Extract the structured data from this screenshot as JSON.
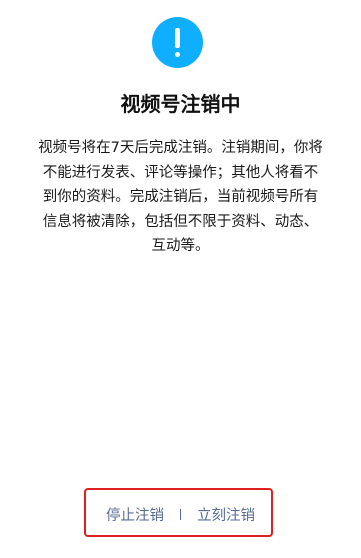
{
  "icon": {
    "name": "exclamation-icon",
    "color": "#10aeff"
  },
  "title": "视频号注销中",
  "notice_lines": [
    "视频号将在7天后完成注销。注销期间，你将",
    "不能进行发表、评论等操作；其他人将看不",
    "到你的资料。完成注销后，当前视频号所有",
    "信息将被清除，包括但不限于资料、动态、",
    "互动等。"
  ],
  "actions": {
    "stop_label": "停止注销",
    "separator": "|",
    "immediate_label": "立刻注销",
    "link_color": "#576b95",
    "highlight_color": "#e02020"
  }
}
